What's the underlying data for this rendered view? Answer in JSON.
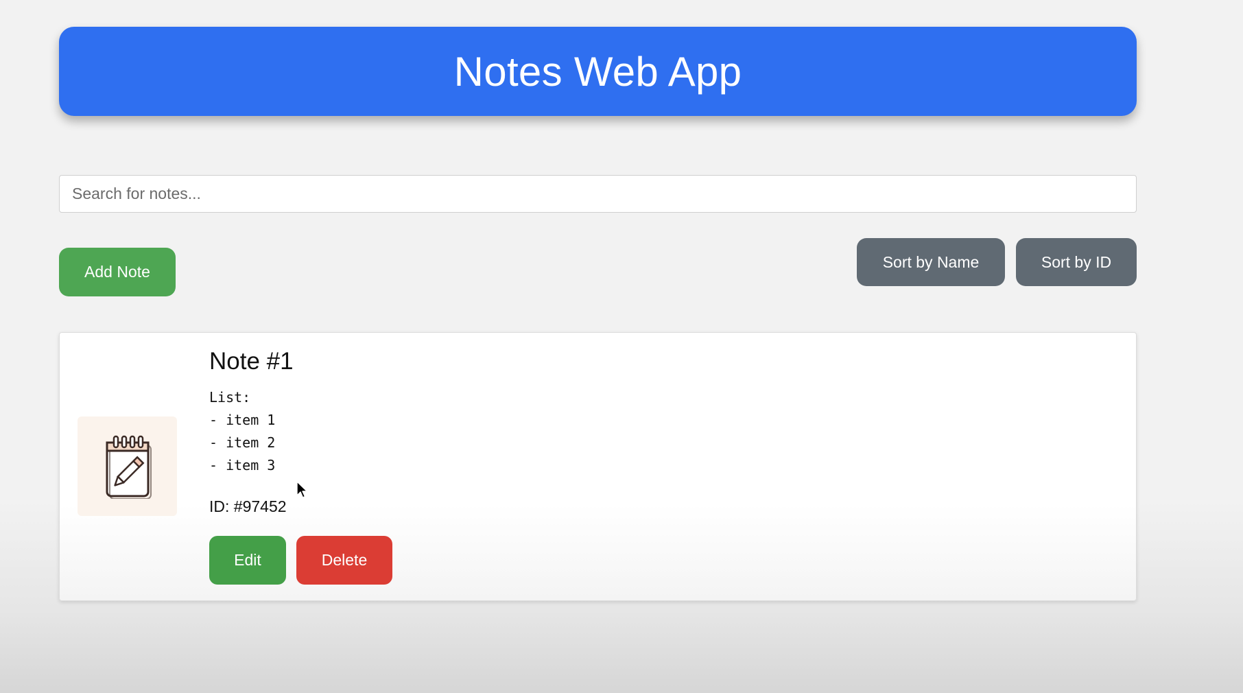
{
  "header": {
    "title": "Notes Web App"
  },
  "search": {
    "placeholder": "Search for notes...",
    "value": ""
  },
  "toolbar": {
    "add_label": "Add Note",
    "sort_name_label": "Sort by Name",
    "sort_id_label": "Sort by ID"
  },
  "notes": [
    {
      "title": "Note #1",
      "body": "List:\n- item 1\n- item 2\n- item 3",
      "id_text": "ID: #97452",
      "icon": "notepad-pencil-icon",
      "edit_label": "Edit",
      "delete_label": "Delete"
    }
  ],
  "colors": {
    "header": "#2f6ff0",
    "add_button": "#4ea653",
    "sort_button": "#606a73",
    "edit_button": "#449f48",
    "delete_button": "#db3d34"
  }
}
